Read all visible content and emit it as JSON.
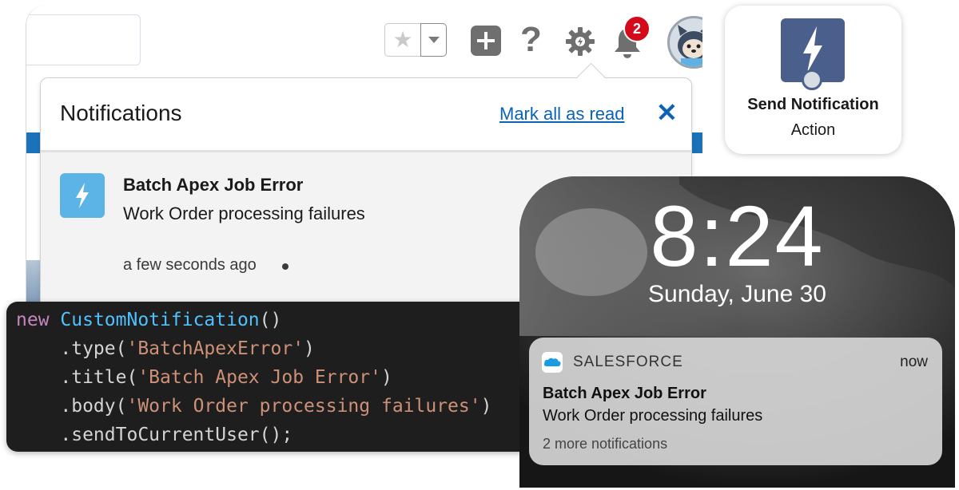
{
  "colors": {
    "brand_blue": "#1b72b8",
    "link_blue": "#0b63b6",
    "badge_red": "#d4091a",
    "notif_icon": "#5bb3e6",
    "action_icon": "#4a5f8c",
    "code_bg": "#1e1e1e"
  },
  "header": {
    "icons": [
      "star-icon",
      "chevron-down-icon",
      "add-icon",
      "help-icon",
      "gear-icon",
      "bell-icon",
      "avatar"
    ],
    "help_glyph": "?",
    "star_glyph": "★",
    "bell_badge": "2"
  },
  "notifications_panel": {
    "title": "Notifications",
    "mark_all_label": "Mark all as read",
    "close_glyph": "✕",
    "items": [
      {
        "title": "Batch Apex Job Error",
        "body": "Work Order processing failures",
        "time": "a few seconds ago"
      }
    ]
  },
  "action_card": {
    "title": "Send Notification",
    "subtitle": "Action"
  },
  "code": {
    "line1_kw": "new",
    "line1_cls": "CustomNotification",
    "line1_rest": "()",
    "line2_method": "    .type(",
    "line2_str": "'BatchApexError'",
    "line2_end": ")",
    "line3_method": "    .title(",
    "line3_str": "'Batch Apex Job Error'",
    "line3_end": ")",
    "line4_method": "    .body(",
    "line4_str": "'Work Order processing failures'",
    "line4_end": ")",
    "line5": "    .sendToCurrentUser();"
  },
  "lock_screen": {
    "time": "8:24",
    "date": "Sunday, June 30",
    "push": {
      "app": "SALESFORCE",
      "when": "now",
      "title": "Batch Apex Job Error",
      "body": "Work Order processing failures",
      "more": "2 more notifications"
    }
  }
}
